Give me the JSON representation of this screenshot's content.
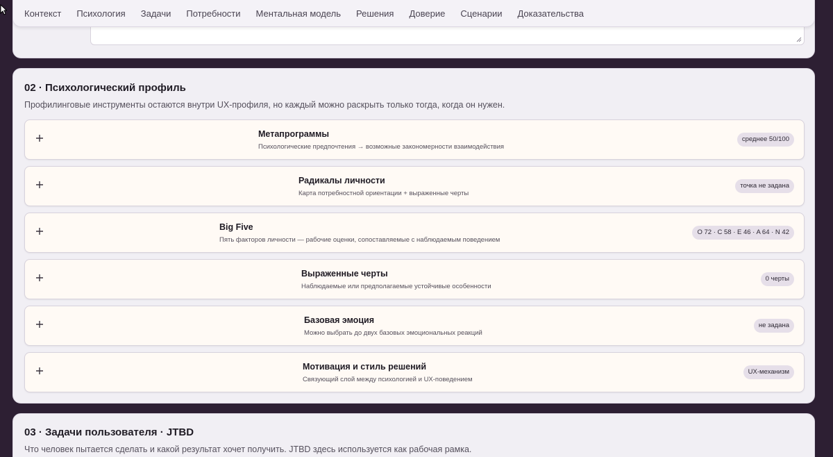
{
  "nav": {
    "items": [
      "Контекст",
      "Психология",
      "Задачи",
      "Потребности",
      "Ментальная модель",
      "Решения",
      "Доверие",
      "Сценарии",
      "Доказательства"
    ]
  },
  "section02": {
    "title": "02 · Психологический профиль",
    "subtitle": "Профилинговые инструменты остаются внутри UX-профиля, но каждый можно раскрыть только тогда, когда он нужен.",
    "items": [
      {
        "title": "Метапрограммы",
        "subtitle": "Психологические предпочтения → возможные закономерности взаимодействия",
        "badge": "среднее 50/100"
      },
      {
        "title": "Радикалы личности",
        "subtitle": "Карта потребностной ориентации + выраженные черты",
        "badge": "точка не задана"
      },
      {
        "title": "Big Five",
        "subtitle": "Пять факторов личности — рабочие оценки, сопоставляемые с наблюдаемым поведением",
        "badge": "O 72 · C 58 · E 46 · A 64 · N 42"
      },
      {
        "title": "Выраженные черты",
        "subtitle": "Наблюдаемые или предполагаемые устойчивые особенности",
        "badge": "0 черты"
      },
      {
        "title": "Базовая эмоция",
        "subtitle": "Можно выбрать до двух базовых эмоциональных реакций",
        "badge": "не задана"
      },
      {
        "title": "Мотивация и стиль решений",
        "subtitle": "Связующий слой между психологией и UX-поведением",
        "badge": "UX-механизм"
      }
    ]
  },
  "section03": {
    "title": "03 · Задачи пользователя · JTBD",
    "subtitle": "Что человек пытается сделать и какой результат хочет получить. JTBD здесь используется как рабочая рамка."
  },
  "icons": {
    "expand": "plus-icon",
    "resize": "resize-grip-icon",
    "cursor": "mouse-cursor-icon"
  }
}
